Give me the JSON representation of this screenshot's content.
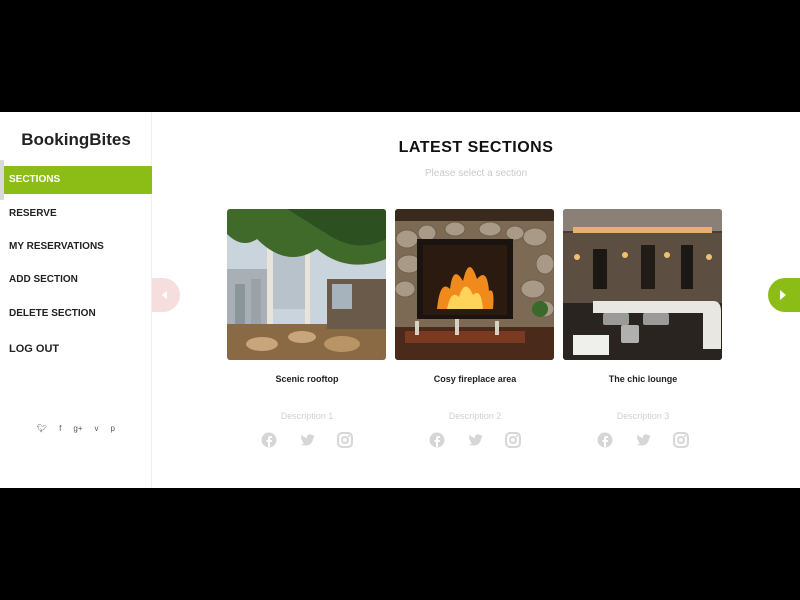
{
  "brand": "BookingBites",
  "nav": [
    {
      "label": "SECTIONS",
      "active": true
    },
    {
      "label": "RESERVE"
    },
    {
      "label": "MY RESERVATIONS"
    },
    {
      "label": "ADD SECTION"
    },
    {
      "label": "DELETE SECTION"
    },
    {
      "label": "LOG OUT"
    }
  ],
  "sidebar_social": [
    {
      "icon": "twitter-icon",
      "glyph": "🐦︎"
    },
    {
      "icon": "facebook-icon",
      "glyph": "f"
    },
    {
      "icon": "google-plus-icon",
      "glyph": "g+"
    },
    {
      "icon": "vimeo-icon",
      "glyph": "v"
    },
    {
      "icon": "pinterest-icon",
      "glyph": "p"
    }
  ],
  "main": {
    "title": "LATEST SECTIONS",
    "subtitle": "Please select a section"
  },
  "cards": [
    {
      "name": "Scenic rooftop",
      "description": "Description 1"
    },
    {
      "name": "Cosy fireplace area",
      "description": "Description 2"
    },
    {
      "name": "The chic lounge",
      "description": "Description 3"
    }
  ],
  "colors": {
    "accent": "#8cbd17",
    "left_arrow_bg": "#f6dede",
    "icon_gray": "#d6d6d6"
  }
}
